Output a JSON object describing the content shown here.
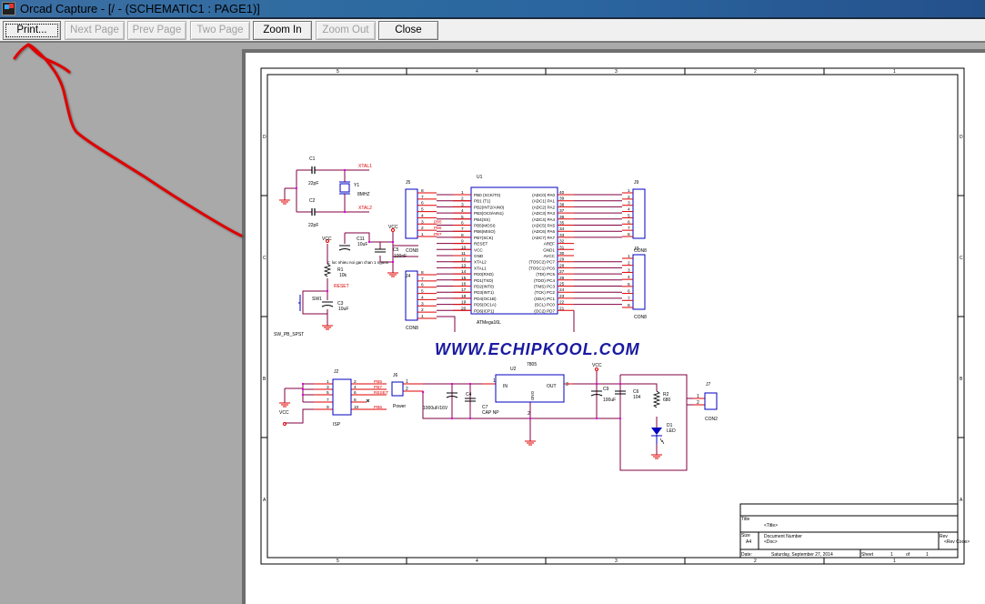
{
  "window": {
    "title": "Orcad Capture - [/ - (SCHEMATIC1 : PAGE1)]",
    "icon": "orcad-app-icon"
  },
  "toolbar": {
    "buttons": [
      {
        "label": "Print...",
        "enabled": true,
        "focused": true
      },
      {
        "label": "Next Page",
        "enabled": false
      },
      {
        "label": "Prev Page",
        "enabled": false
      },
      {
        "label": "Two Page",
        "enabled": false
      },
      {
        "label": "Zoom In",
        "enabled": true
      },
      {
        "label": "Zoom Out",
        "enabled": false
      },
      {
        "label": "Close",
        "enabled": true
      }
    ]
  },
  "annotation": {
    "type": "red-arrow",
    "color": "#e00000",
    "points_to": "Print..."
  },
  "schematic": {
    "border_columns": [
      "5",
      "4",
      "3",
      "2",
      "1"
    ],
    "border_rows": [
      "D",
      "C",
      "B",
      "A"
    ],
    "watermark": "WWW.ECHIPKOOL.COM",
    "title_block": {
      "title_label": "Title",
      "title_value": "<Title>",
      "size_label": "Size",
      "size_value": "A4",
      "docnum_label": "Document Number",
      "docnum_value": "<Doc>",
      "rev_label": "Rev",
      "rev_value": "<Rev Code>",
      "date_label": "Date:",
      "date_value": "Saturday, September 27, 2014",
      "sheet_label": "Sheet",
      "sheet_value": "1",
      "of_label": "of",
      "of_value": "1"
    },
    "crystal_section": {
      "c1": {
        "ref": "C1",
        "value": "22pF"
      },
      "c2": {
        "ref": "C2",
        "value": "22pF"
      },
      "y1": {
        "ref": "Y1",
        "value": "8MHZ"
      },
      "nets": [
        "XTAL1",
        "XTAL2"
      ]
    },
    "reset_section": {
      "vcc": "VCC",
      "r1": {
        "ref": "R1",
        "value": "10k"
      },
      "c3": {
        "ref": "C3",
        "value": "10uF"
      },
      "sw1": {
        "ref": "SW1",
        "value": "SW_PB_SPST"
      },
      "c11": {
        "ref": "C11",
        "value": "10uF"
      },
      "c5": {
        "ref": "C5",
        "value": "100nF"
      },
      "net": "RESET",
      "note": "c: loc nhieu noi gan chan 1 nguon"
    },
    "mcu": {
      "ref": "U1",
      "part": "ATMega16L",
      "left_pins": [
        {
          "num": "1",
          "name": "PB0 (XCK/T0)"
        },
        {
          "num": "2",
          "name": "PB1 (T1)"
        },
        {
          "num": "3",
          "name": "PB2(INT2/AIN0)"
        },
        {
          "num": "4",
          "name": "PB3(OC0/AIN1)"
        },
        {
          "num": "5",
          "name": "PB4(SS)"
        },
        {
          "num": "6",
          "name": "PB5(MOSI)"
        },
        {
          "num": "7",
          "name": "PB6(MISO)"
        },
        {
          "num": "8",
          "name": "PB7(SCK)"
        },
        {
          "num": "9",
          "name": "RESET"
        },
        {
          "num": "10",
          "name": "VCC"
        },
        {
          "num": "11",
          "name": "GND"
        },
        {
          "num": "12",
          "name": "XTAL2"
        },
        {
          "num": "13",
          "name": "XTAL1"
        },
        {
          "num": "14",
          "name": "PD0(RXD)"
        },
        {
          "num": "15",
          "name": "PD1(TXD)"
        },
        {
          "num": "16",
          "name": "PD2(INT0)"
        },
        {
          "num": "17",
          "name": "PD3(INT1)"
        },
        {
          "num": "18",
          "name": "PD4(OC1B)"
        },
        {
          "num": "19",
          "name": "PD5(OC1A)"
        },
        {
          "num": "20",
          "name": "PD6(ICP1)"
        }
      ],
      "right_pins": [
        {
          "num": "40",
          "name": "(ADC0) PA0"
        },
        {
          "num": "39",
          "name": "(ADC1) PA1"
        },
        {
          "num": "38",
          "name": "(ADC2) PA2"
        },
        {
          "num": "37",
          "name": "(ADC3) PA3"
        },
        {
          "num": "36",
          "name": "(ADC4) PA4"
        },
        {
          "num": "35",
          "name": "(ADC5) PA5"
        },
        {
          "num": "34",
          "name": "(ADC6) PA6"
        },
        {
          "num": "33",
          "name": "(ADC7) PA7"
        },
        {
          "num": "32",
          "name": "AREF"
        },
        {
          "num": "31",
          "name": "GND1"
        },
        {
          "num": "30",
          "name": "AVCC"
        },
        {
          "num": "29",
          "name": "(TOSC2) PC7"
        },
        {
          "num": "28",
          "name": "(TOSC1) PC6"
        },
        {
          "num": "27",
          "name": "(TDI) PC5"
        },
        {
          "num": "26",
          "name": "(TDO) PC4"
        },
        {
          "num": "25",
          "name": "(TMS) PC3"
        },
        {
          "num": "24",
          "name": "(TCK) PC2"
        },
        {
          "num": "23",
          "name": "(SDA) PC1"
        },
        {
          "num": "22",
          "name": "(SCL) PC0"
        },
        {
          "num": "21",
          "name": "(OC2) PD7"
        }
      ]
    },
    "connectors": {
      "j5": {
        "ref": "J5",
        "value": "CON8",
        "pins": [
          "8",
          "7",
          "6",
          "5",
          "4",
          "3",
          "2",
          "1"
        ],
        "nets": [
          "",
          "",
          "",
          "",
          "",
          "PB5",
          "PB6",
          "PB7"
        ]
      },
      "j9": {
        "ref": "J9",
        "value": "CON8",
        "pins": [
          "1",
          "2",
          "3",
          "4",
          "5",
          "6",
          "7",
          "8"
        ]
      },
      "j3": {
        "ref": "J3",
        "value": "CON8",
        "pins": [
          "1",
          "2",
          "3",
          "4",
          "5",
          "6",
          "7",
          "8"
        ]
      },
      "j4": {
        "ref": "J4",
        "value": "CON8",
        "pins": [
          "8",
          "7",
          "6",
          "5",
          "4",
          "3",
          "2",
          "1"
        ]
      },
      "j2": {
        "ref": "J2",
        "value": "ISP",
        "left_pins": [
          "1",
          "3",
          "5",
          "7",
          "9"
        ],
        "right_pins": [
          "2",
          "4",
          "6",
          "8",
          "10"
        ],
        "nets": [
          "PB5",
          "PB7",
          "RESET",
          "",
          "PB6"
        ]
      },
      "j6": {
        "ref": "J6",
        "value": "Power",
        "pins": [
          "1",
          "2"
        ]
      },
      "j7": {
        "ref": "J7",
        "value": "CON2",
        "pins": [
          "1",
          "2"
        ]
      }
    },
    "power_section": {
      "u2": {
        "ref": "U2",
        "value": "7805",
        "pin_in": "IN",
        "pin_out": "OUT",
        "pin_gnd": "GND",
        "nums": [
          "1",
          "3",
          "2"
        ]
      },
      "c_bulk": {
        "ref": "",
        "value": "1000uF/16V"
      },
      "c4": {
        "ref": "C4",
        "value": ""
      },
      "c7": {
        "ref": "C7",
        "value": "CAP NP"
      },
      "c9": {
        "ref": "C9",
        "value": "100uF"
      },
      "c6": {
        "ref": "C6",
        "value": "104"
      },
      "r2": {
        "ref": "R2",
        "value": "680"
      },
      "d1": {
        "ref": "D1",
        "value": "LED"
      },
      "vcc": "VCC"
    },
    "colors": {
      "wire": "#800040",
      "pin": "#e00000",
      "part": "#0000c0",
      "text": "#000000",
      "netlabel": "#e00000",
      "junction": "#e000e0"
    }
  }
}
